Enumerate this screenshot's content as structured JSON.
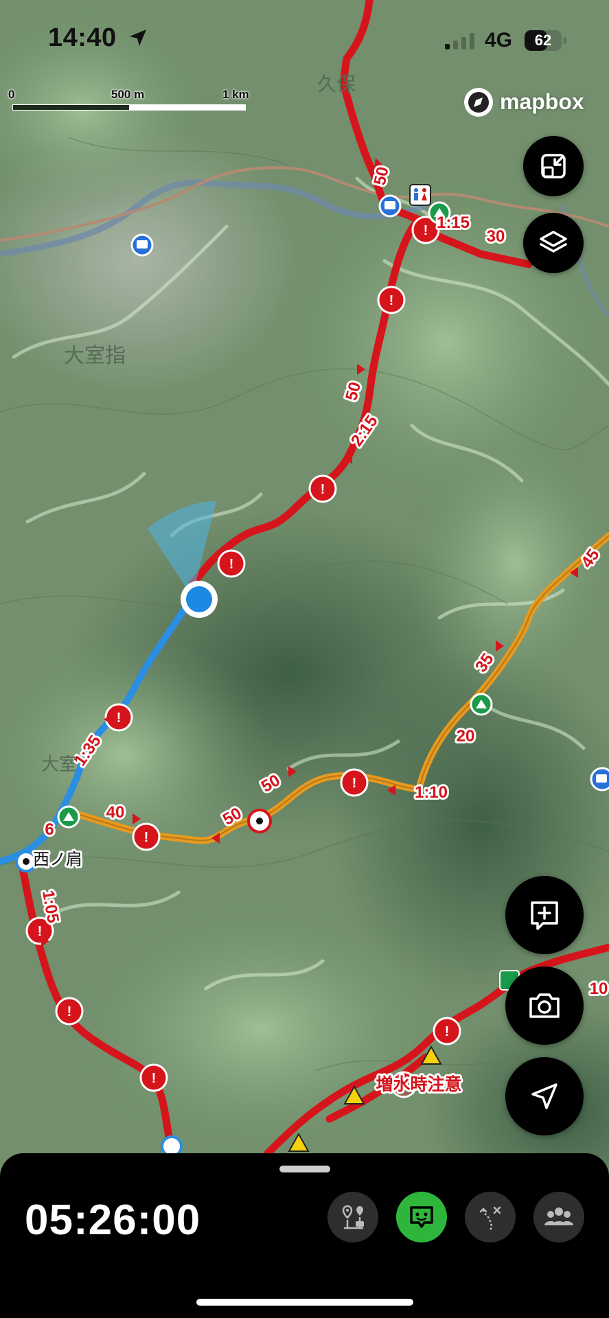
{
  "status_bar": {
    "time": "14:40",
    "network": "4G",
    "battery_level": "62",
    "battery_fraction": 0.62
  },
  "scale_bar": {
    "labels": [
      "0",
      "500 m",
      "1 km"
    ]
  },
  "attribution": {
    "logo_text": "mapbox"
  },
  "map": {
    "place_labels": [
      "久保",
      "大室指",
      "大室"
    ],
    "peak_label": "西ノ肩",
    "caution_label": "増水時注意",
    "time_labels": [
      "50",
      "1:15",
      "30",
      "50",
      "2:15",
      "1:35",
      "6",
      "40",
      "50",
      "50",
      "1:10",
      "20",
      "35",
      "45",
      "1:05",
      "10"
    ],
    "colors": {
      "trail_red": "#d6141b",
      "trail_orange": "#f0a020",
      "track_blue": "#2b8ee0",
      "user_dot": "#1e88e5"
    }
  },
  "buttons": {
    "fit": {
      "icon": "collapse-icon"
    },
    "layers": {
      "icon": "layers-icon"
    },
    "add_note": {
      "icon": "add-note-icon"
    },
    "camera": {
      "icon": "camera-icon"
    },
    "locate": {
      "icon": "navigation-icon"
    }
  },
  "bottom_panel": {
    "elapsed_time": "05:26:00",
    "actions": [
      {
        "name": "waypoints",
        "icon": "waypoints-icon"
      },
      {
        "name": "chat",
        "icon": "chat-icon",
        "active": true
      },
      {
        "name": "route",
        "icon": "route-icon"
      },
      {
        "name": "group",
        "icon": "group-icon"
      }
    ]
  }
}
